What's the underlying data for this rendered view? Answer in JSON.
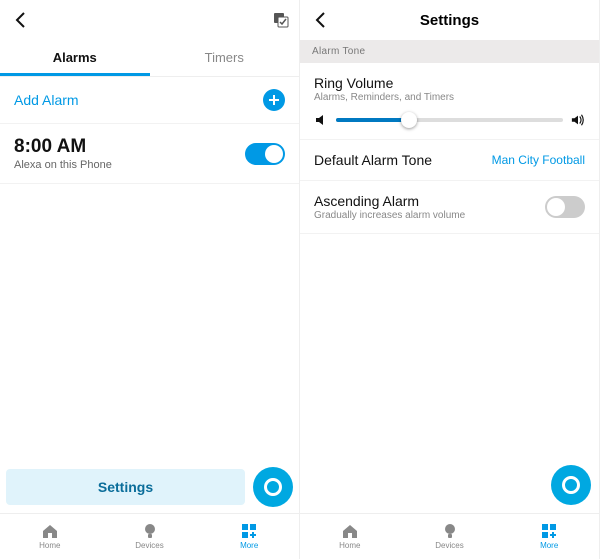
{
  "left": {
    "tabs": {
      "alarms": "Alarms",
      "timers": "Timers"
    },
    "add_alarm": "Add Alarm",
    "alarm": {
      "time": "8:00 AM",
      "device": "Alexa on this Phone"
    },
    "settings_button": "Settings"
  },
  "right": {
    "title": "Settings",
    "section": "Alarm Tone",
    "ring_volume": {
      "title": "Ring Volume",
      "sub": "Alarms, Reminders, and Timers"
    },
    "default_tone": {
      "title": "Default Alarm Tone",
      "value": "Man City Football"
    },
    "ascending": {
      "title": "Ascending Alarm",
      "sub": "Gradually increases alarm volume"
    }
  },
  "nav": {
    "home": "Home",
    "devices": "Devices",
    "more": "More"
  }
}
